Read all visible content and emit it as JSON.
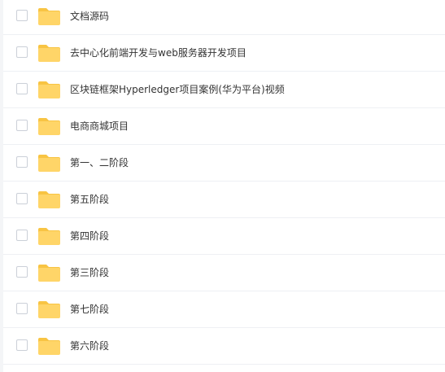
{
  "file_list": {
    "items": [
      {
        "name": "文档源码",
        "type": "folder",
        "checked": false
      },
      {
        "name": "去中心化前端开发与web服务器开发项目",
        "type": "folder",
        "checked": false
      },
      {
        "name": "区块链框架Hyperledger项目案例(华为平台)视频",
        "type": "folder",
        "checked": false
      },
      {
        "name": "电商商城项目",
        "type": "folder",
        "checked": false
      },
      {
        "name": "第一、二阶段",
        "type": "folder",
        "checked": false
      },
      {
        "name": "第五阶段",
        "type": "folder",
        "checked": false
      },
      {
        "name": "第四阶段",
        "type": "folder",
        "checked": false
      },
      {
        "name": "第三阶段",
        "type": "folder",
        "checked": false
      },
      {
        "name": "第七阶段",
        "type": "folder",
        "checked": false
      },
      {
        "name": "第六阶段",
        "type": "folder",
        "checked": false
      }
    ]
  },
  "colors": {
    "folder_body": "#FFD568",
    "folder_tab": "#F8C443",
    "text": "#333333",
    "divider": "#EEF0F4",
    "checkbox_border": "#CBD0D8"
  },
  "icons": {
    "folder": "folder-icon",
    "checkbox": "checkbox"
  }
}
